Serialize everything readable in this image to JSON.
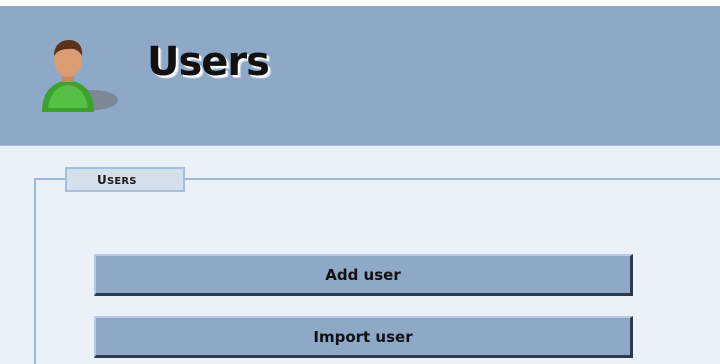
{
  "header": {
    "title": "Users",
    "icon": "user-icon"
  },
  "section": {
    "legend_first": "U",
    "legend_rest": "SERS"
  },
  "actions": {
    "add_user_label": "Add user",
    "import_user_label": "Import user"
  },
  "colors": {
    "header_background": "#8ea8c8",
    "page_background": "#eaf1f9",
    "button_background": "#8ea8c8",
    "fieldset_border": "#9cb7d9"
  }
}
